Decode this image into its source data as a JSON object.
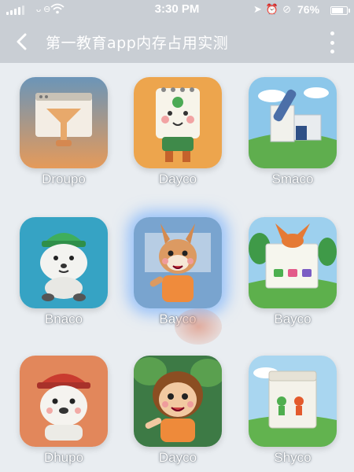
{
  "status_bar": {
    "carrier": "ᴗ ⊖",
    "time": "3:30 PM",
    "battery_percent": "76%",
    "battery_level": 0.76,
    "icons": [
      "location-icon",
      "alarm-icon",
      "do-not-disturb-icon"
    ]
  },
  "nav": {
    "title": "第一教育app内存占用实测",
    "back_icon": "chevron-left-icon",
    "more_icon": "more-vertical-icon"
  },
  "apps": [
    {
      "label": "Droupo",
      "icon": "funnel-window-icon"
    },
    {
      "label": "Dayco",
      "icon": "notepad-bear-icon"
    },
    {
      "label": "Smaco",
      "icon": "building-blocks-icon"
    },
    {
      "label": "Bnaco",
      "icon": "seal-beanie-icon"
    },
    {
      "label": "Bayco",
      "icon": "bunny-character-icon",
      "selected": true
    },
    {
      "label": "Bayco",
      "icon": "fox-color-board-icon"
    },
    {
      "label": "Dhupo",
      "icon": "bear-cap-icon"
    },
    {
      "label": "Dayco",
      "icon": "cartoon-girl-icon"
    },
    {
      "label": "Shyco",
      "icon": "box-characters-icon"
    }
  ],
  "colors": {
    "bar": "#c9ced4",
    "background": "#e9edf1",
    "selection_glow": "#5aa0ff"
  }
}
